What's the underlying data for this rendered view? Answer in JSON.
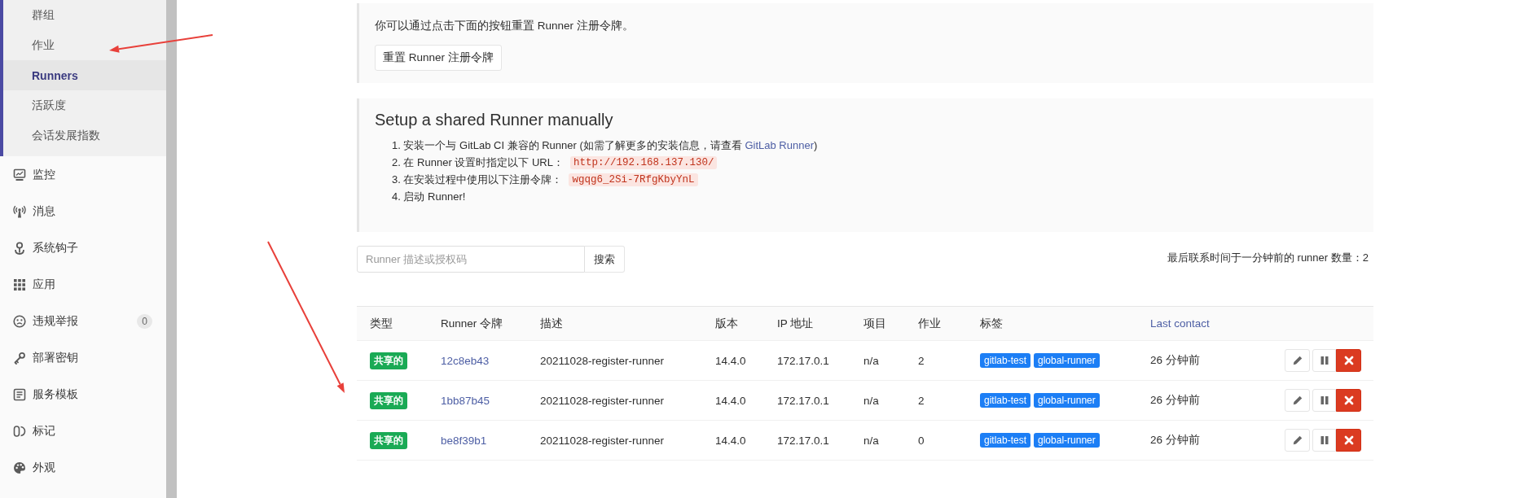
{
  "sidebar": {
    "sub_items": [
      {
        "label": "群组",
        "selected": false
      },
      {
        "label": "作业",
        "selected": false
      },
      {
        "label": "Runners",
        "selected": true
      },
      {
        "label": "活跃度",
        "selected": false
      },
      {
        "label": "会话发展指数",
        "selected": false
      }
    ],
    "items": [
      {
        "label": "监控"
      },
      {
        "label": "消息"
      },
      {
        "label": "系统钩子"
      },
      {
        "label": "应用"
      },
      {
        "label": "违规举报",
        "badge": "0"
      },
      {
        "label": "部署密钥"
      },
      {
        "label": "服务模板"
      },
      {
        "label": "标记"
      },
      {
        "label": "外观"
      }
    ]
  },
  "reset_panel": {
    "text": "你可以通过点击下面的按钮重置 Runner 注册令牌。",
    "button": "重置 Runner 注册令牌"
  },
  "setup_panel": {
    "title": "Setup a shared Runner manually",
    "steps": [
      {
        "number": "1.",
        "text": "安装一个与 GitLab CI 兼容的 Runner (如需了解更多的安装信息，请查看 ",
        "link": "GitLab Runner",
        "text_after": ")"
      },
      {
        "number": "2.",
        "text": "在 Runner 设置时指定以下 URL：",
        "code": "http://192.168.137.130/"
      },
      {
        "number": "3.",
        "text": "在安装过程中使用以下注册令牌：",
        "code": "wgqg6_2Si-7RfgKbyYnL"
      },
      {
        "number": "4.",
        "text": "启动 Runner!"
      }
    ]
  },
  "search": {
    "placeholder": "Runner 描述或授权码",
    "button": "搜索"
  },
  "runner_count": "最后联系时间于一分钟前的 runner 数量：2",
  "table": {
    "columns": [
      {
        "label": "类型",
        "kind": "text"
      },
      {
        "label": "Runner 令牌",
        "kind": "text"
      },
      {
        "label": "描述",
        "kind": "text"
      },
      {
        "label": "版本",
        "kind": "text"
      },
      {
        "label": "IP 地址",
        "kind": "text"
      },
      {
        "label": "项目",
        "kind": "text"
      },
      {
        "label": "作业",
        "kind": "text"
      },
      {
        "label": "标签",
        "kind": "text"
      },
      {
        "label": "Last contact",
        "kind": "link"
      }
    ],
    "rows": [
      {
        "type": "共享的",
        "token": "12c8eb43",
        "description": "20211028-register-runner",
        "version": "14.4.0",
        "ip": "172.17.0.1",
        "projects": "n/a",
        "jobs": "2",
        "tags": [
          "gitlab-test",
          "global-runner"
        ],
        "last_contact": "26 分钟前"
      },
      {
        "type": "共享的",
        "token": "1bb87b45",
        "description": "20211028-register-runner",
        "version": "14.4.0",
        "ip": "172.17.0.1",
        "projects": "n/a",
        "jobs": "2",
        "tags": [
          "gitlab-test",
          "global-runner"
        ],
        "last_contact": "26 分钟前"
      },
      {
        "type": "共享的",
        "token": "be8f39b1",
        "description": "20211028-register-runner",
        "version": "14.4.0",
        "ip": "172.17.0.1",
        "projects": "n/a",
        "jobs": "0",
        "tags": [
          "gitlab-test",
          "global-runner"
        ],
        "last_contact": "26 分钟前"
      }
    ]
  }
}
